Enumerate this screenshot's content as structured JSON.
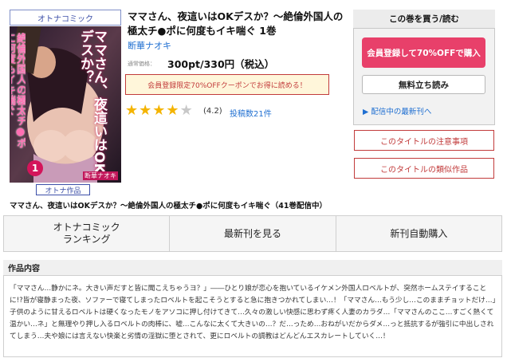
{
  "category_badge": "オトナコミック",
  "adult_badge": "オトナ作品",
  "cover": {
    "title_text": "ママさん、夜這いはOKデスか？",
    "sub_text": "絶倫外国人の極太チ●ポに何度もイキ喘ぐ",
    "volume": "1",
    "author_text": "断華ナオキ"
  },
  "book": {
    "title": "ママさん、夜這いはOKデスか？～絶倫外国人の極太チ●ポに何度もイキ喘ぐ 1巻",
    "author": "断華ナオキ",
    "price_label": "通常価格：",
    "price": "300pt/330円（税込）",
    "coupon": "会員登録限定70%OFFクーポンでお得に読める！",
    "rating_value": 4.2,
    "rating_text": "(4.2)",
    "reviews": "投稿数21件"
  },
  "buy_panel": {
    "header": "この巻を買う/読む",
    "register_button": "会員登録して70%OFFで購入",
    "free_read_button": "無料立ち読み",
    "latest_link": "▶ 配信中の最新刊へ"
  },
  "notes_button": "このタイトルの注意事項",
  "similar_button": "このタイトルの類似作品",
  "series_subtitle": "ママさん、夜這いはOKデスか？～絶倫外国人の極太チ●ポに何度もイキ喘ぐ（41巻配信中）",
  "tabs": [
    {
      "label": "オトナコミック\nランキング"
    },
    {
      "label": "最新刊を見る"
    },
    {
      "label": "新刊自動購入"
    }
  ],
  "section_header": "作品内容",
  "description": "「ママさん…静かにネ。大きい声だすと皆に聞こえちゃうヨ？」――ひとり娘が恋心を抱いているイケメン外国人ロベルトが、突然ホームステイすることに!?皆が寝静まった夜、ソファーで寝てしまったロベルトを起こそうとすると急に抱きつかれてしまい…！「ママさん…もう少し…このままチョットだけ…」子供のように甘えるロベルトは硬くなったモノをアソコに押し付けてきて…久々の激しい快感に思わず疼く人妻のカラダ…「ママさんのここ…すごく熱くて温かい…ネ」と無理やり押し入るロベルトの肉棒に、嘘…こんなに太くて大きいの…？だ…っため…おねがいだからダメ…っと抵抗するが強引に中出しされてしまう…夫や娘には言えない快楽と劣情の淫獄に堕とされて、更にロベルトの調教はどんどんエスカレートしていく…！",
  "colors": {
    "accent_red": "#e8406a",
    "link_blue": "#1f6fd1",
    "star": "#f4b400"
  }
}
